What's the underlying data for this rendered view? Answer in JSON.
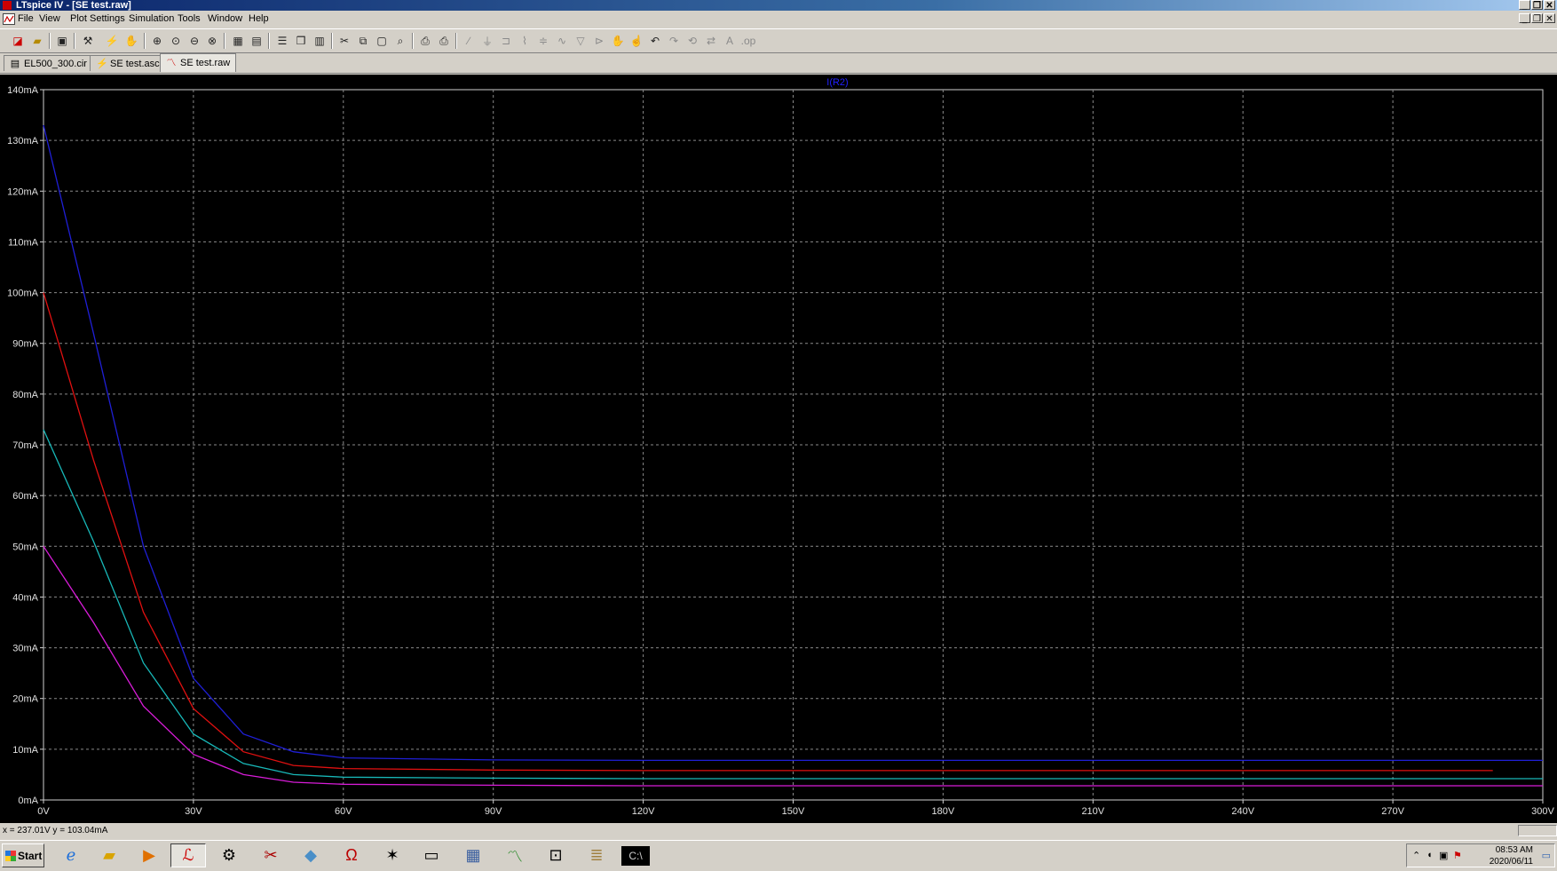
{
  "window": {
    "title": "LTspice IV - [SE test.raw]"
  },
  "menu": [
    {
      "label": "File"
    },
    {
      "label": "View"
    },
    {
      "label": "Plot Settings"
    },
    {
      "label": "Simulation"
    },
    {
      "label": "Tools"
    },
    {
      "label": "Window"
    },
    {
      "label": "Help"
    }
  ],
  "tabs": [
    {
      "label": "EL500_300.cir",
      "icon": "netlist-icon"
    },
    {
      "label": "SE test.asc",
      "icon": "schematic-icon"
    },
    {
      "label": "SE test.raw",
      "icon": "waveform-icon",
      "active": true
    }
  ],
  "chart_data": {
    "type": "line",
    "title": "I(R2)",
    "xlabel": "",
    "ylabel": "",
    "xlim": [
      0,
      300
    ],
    "ylim": [
      0,
      140
    ],
    "x_ticks": [
      "0V",
      "30V",
      "60V",
      "90V",
      "120V",
      "150V",
      "180V",
      "210V",
      "240V",
      "270V",
      "300V"
    ],
    "y_ticks": [
      "0mA",
      "10mA",
      "20mA",
      "30mA",
      "40mA",
      "50mA",
      "60mA",
      "70mA",
      "80mA",
      "90mA",
      "100mA",
      "110mA",
      "120mA",
      "130mA",
      "140mA"
    ],
    "grid": true,
    "series": [
      {
        "color": "#1f1fd6",
        "x": [
          0,
          10,
          20,
          30,
          40,
          50,
          60,
          90,
          120,
          150,
          180,
          210,
          240,
          270,
          300
        ],
        "y": [
          133,
          92,
          50,
          24,
          13,
          9.5,
          8.3,
          7.9,
          7.8,
          7.8,
          7.8,
          7.8,
          7.8,
          7.8,
          7.8
        ]
      },
      {
        "color": "#e01010",
        "x": [
          0,
          10,
          20,
          30,
          40,
          50,
          60,
          90,
          120,
          150,
          180,
          210,
          240,
          270,
          290
        ],
        "y": [
          100,
          67,
          37,
          18,
          9.5,
          6.8,
          6.2,
          5.9,
          5.8,
          5.8,
          5.8,
          5.8,
          5.8,
          5.8,
          5.8
        ]
      },
      {
        "color": "#18b8b8",
        "x": [
          0,
          10,
          20,
          30,
          40,
          50,
          60,
          90,
          120,
          150,
          180,
          210,
          240,
          270,
          300
        ],
        "y": [
          73,
          51,
          27,
          13,
          7.2,
          5.0,
          4.5,
          4.3,
          4.2,
          4.2,
          4.2,
          4.2,
          4.2,
          4.2,
          4.2
        ]
      },
      {
        "color": "#d81cd8",
        "x": [
          0,
          10,
          20,
          30,
          40,
          50,
          60,
          90,
          120,
          150,
          180,
          210,
          240,
          270,
          300
        ],
        "y": [
          50,
          35,
          18.5,
          9,
          5,
          3.5,
          3.1,
          2.9,
          2.8,
          2.8,
          2.8,
          2.8,
          2.8,
          2.8,
          2.8
        ]
      }
    ]
  },
  "status": {
    "cursor": "x = 237.01V   y = 103.04mA"
  },
  "taskbar": {
    "start_label": "Start",
    "clock_time": "08:53 AM",
    "clock_date": "2020/06/11"
  }
}
